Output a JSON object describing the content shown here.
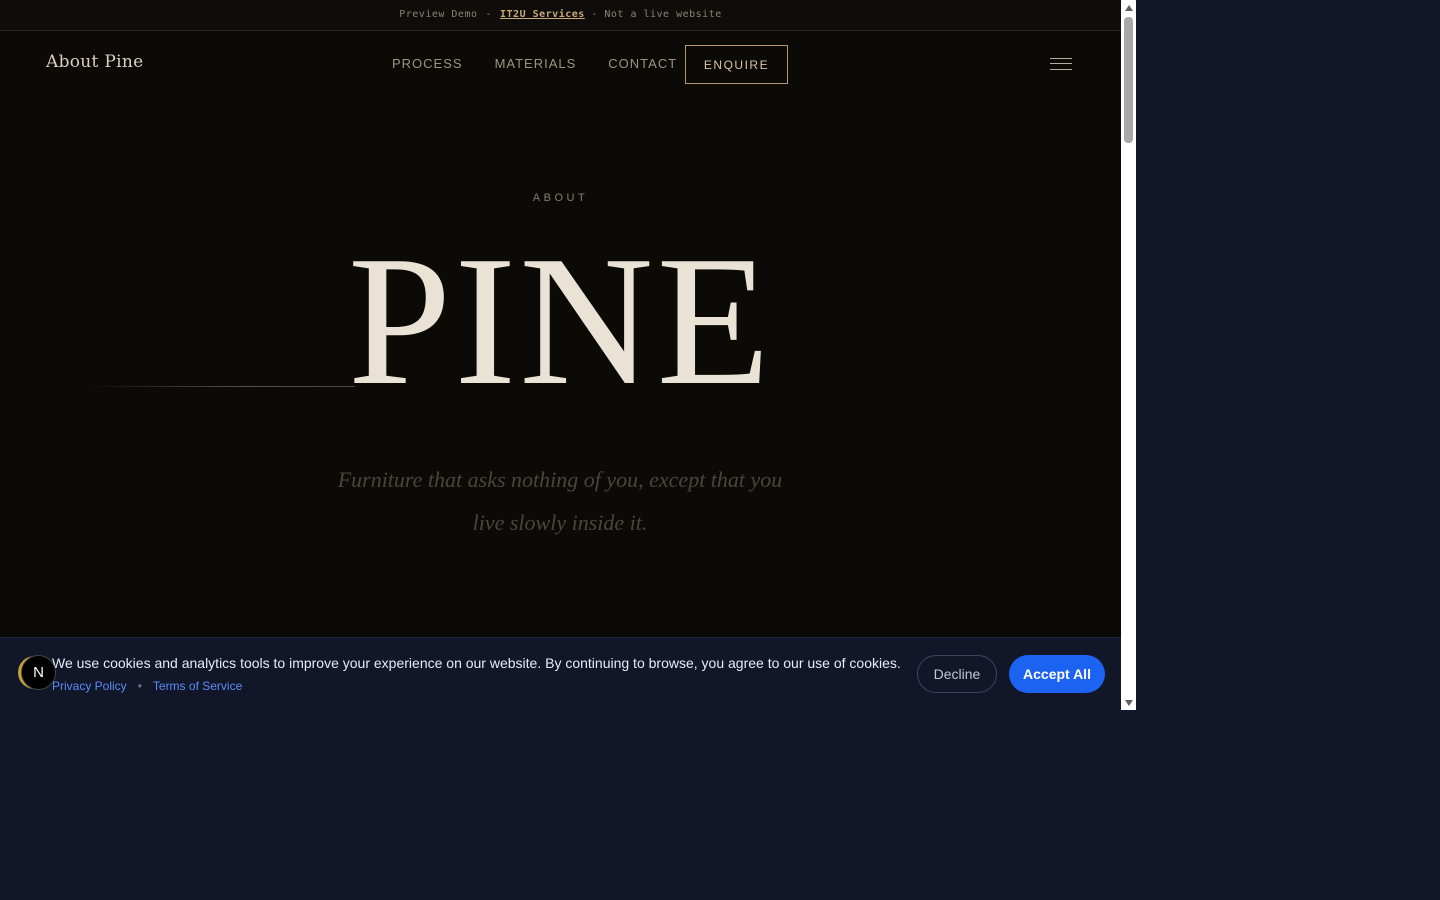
{
  "preview_banner": {
    "prefix": "Preview Demo",
    "separator": "-",
    "link": "IT2U Services",
    "suffix": "- Not a live website"
  },
  "nav": {
    "brand": "About Pine",
    "links": [
      "PROCESS",
      "MATERIALS",
      "CONTACT"
    ],
    "enquire_label": "ENQUIRE",
    "menu_icon": "hamburger-icon"
  },
  "hero": {
    "eyebrow": "ABOUT",
    "title": "PINE",
    "tagline": "Furniture that asks nothing of you, except that you live slowly inside it."
  },
  "cookie": {
    "avatar_letter": "N",
    "message": "We use cookies and analytics tools to improve your experience on our website. By continuing to browse, you agree to our use of cookies.",
    "privacy_label": "Privacy Policy",
    "dot": "•",
    "terms_label": "Terms of Service",
    "decline_label": "Decline",
    "accept_label": "Accept All"
  },
  "colors": {
    "page_background": "#0c0a07",
    "accent_gold": "#b8946a",
    "cookie_background": "#111629",
    "accept_blue": "#1d63f2",
    "link_blue": "#5b8cf7"
  }
}
